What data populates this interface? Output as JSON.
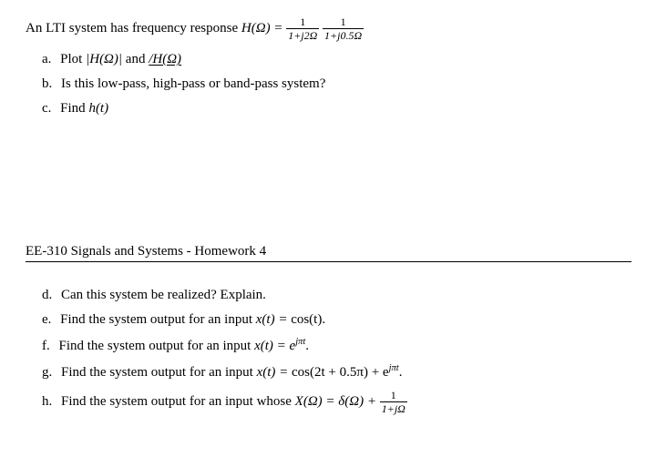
{
  "intro_prefix": "An LTI system has frequency response ",
  "items1": {
    "a": {
      "label": "a.",
      "prefix": "Plot "
    },
    "b": {
      "label": "b.",
      "text": "Is this low-pass, high-pass or band-pass system?"
    },
    "c": {
      "label": "c.",
      "prefix": "Find "
    }
  },
  "header": "EE-310 Signals and Systems - Homework 4",
  "items2": {
    "d": {
      "label": "d.",
      "text": "Can this system be realized? Explain."
    },
    "e": {
      "label": "e.",
      "prefix": "Find the system output for an input "
    },
    "f": {
      "label": "f.",
      "prefix": "Find the system output for an input "
    },
    "g": {
      "label": "g.",
      "prefix": "Find the system output for an input "
    },
    "h": {
      "label": "h.",
      "prefix": "Find the system output for an input whose "
    }
  },
  "math": {
    "H_eq": "H(Ω) =",
    "frac1_num": "1",
    "frac1_den": "1+j2Ω",
    "frac2_num": "1",
    "frac2_den": "1+j0.5Ω",
    "absH": "|H(Ω)|",
    "and": " and ",
    "angH": "/H(Ω)",
    "ht": "h(t)",
    "xt_eq": "x(t) = ",
    "cos_t": "cos(t)",
    "ejpit": "e",
    "ejpit_sup": "jπt",
    "cos2t": "cos(2t + 0.5π) + e",
    "X_eq": "X(Ω) = δ(Ω) + ",
    "fracX_num": "1",
    "fracX_den": "1+jΩ",
    "period": "."
  }
}
